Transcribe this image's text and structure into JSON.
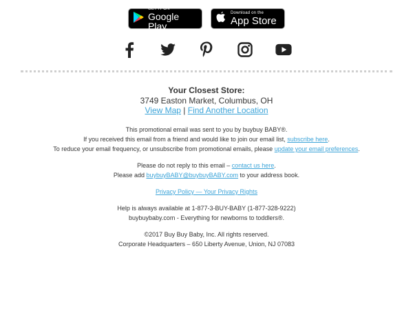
{
  "app_badges": {
    "google_small": "GET IT ON",
    "google_big": "Google Play",
    "apple_small": "Download on the",
    "apple_big": "App Store"
  },
  "social_icons": [
    "facebook-icon",
    "twitter-icon",
    "pinterest-icon",
    "instagram-icon",
    "youtube-icon"
  ],
  "store": {
    "title": "Your Closest Store:",
    "address": "3749 Easton Market, Columbus, OH",
    "view_map": "View Map",
    "separator": " | ",
    "find_another": "Find Another Location"
  },
  "promo": {
    "line1": "This promotional email was sent to you by buybuy BABY®.",
    "line2_pre": "If you received this email from a friend and would like to join our email list, ",
    "line2_link": "subscribe here",
    "line2_post": ".",
    "line3_pre": "To reduce your email frequency, or unsubscribe from promotional emails, please ",
    "line3_link": "update your email preferences",
    "line3_post": "."
  },
  "reply": {
    "line1_pre": "Please do not reply to this email – ",
    "line1_link": "contact us here",
    "line1_post": ".",
    "line2_pre": "Please add ",
    "line2_link": "buybuyBABY@buybuyBABY.com",
    "line2_post": " to your address book."
  },
  "privacy": {
    "link": "Privacy Policy — Your Privacy Rights"
  },
  "help": {
    "line1": "Help is always available at 1-877-3-BUY-BABY (1-877-328-9222)",
    "line2": "buybuybaby.com - Everything for newborns to toddlers®."
  },
  "legal": {
    "copyright": "©2017 Buy Buy Baby, Inc. All rights reserved.",
    "hq": "Corporate Headquarters – 650 Liberty Avenue, Union, NJ 07083"
  },
  "colors": {
    "link": "#3aa3d8",
    "text": "#333333",
    "icons": "#222222",
    "divider": "#cfcfcf"
  }
}
